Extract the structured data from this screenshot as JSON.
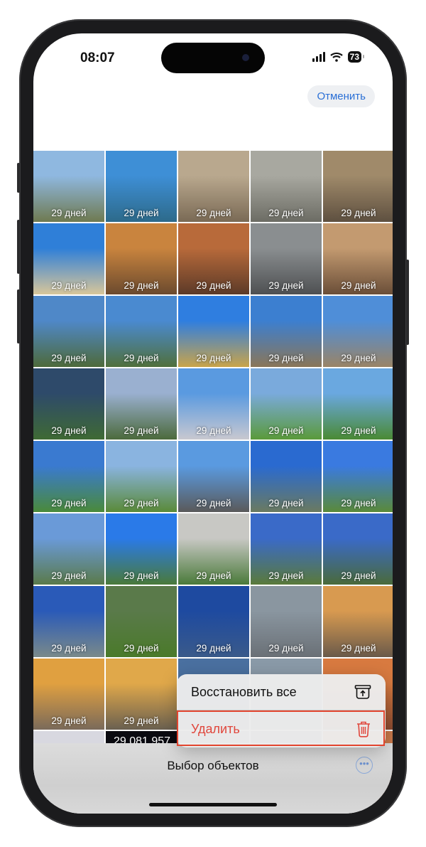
{
  "status_bar": {
    "time": "08:07",
    "battery": "73"
  },
  "header": {
    "cancel_label": "Отменить"
  },
  "tiles": [
    {
      "label": "29 дней",
      "top": "#8fb8e0",
      "bottom": "#6f7a50"
    },
    {
      "label": "29 дней",
      "top": "#3e8fd6",
      "bottom": "#2d6a8a"
    },
    {
      "label": "29 дней",
      "top": "#b9a88e",
      "bottom": "#7a6a55"
    },
    {
      "label": "29 дней",
      "top": "#a8a8a0",
      "bottom": "#6c6c64"
    },
    {
      "label": "29 дней",
      "top": "#a08a6a",
      "bottom": "#5e5040"
    },
    {
      "label": "29 дней",
      "top": "#2f7fd8",
      "bottom": "#d8c69a"
    },
    {
      "label": "29 дней",
      "top": "#c9843e",
      "bottom": "#6b4a2e"
    },
    {
      "label": "29 дней",
      "top": "#b86a3a",
      "bottom": "#5c3a28"
    },
    {
      "label": "29 дней",
      "top": "#8a8e90",
      "bottom": "#4e5052"
    },
    {
      "label": "29 дней",
      "top": "#c39a70",
      "bottom": "#6a4e38"
    },
    {
      "label": "29 дней",
      "top": "#4f88c8",
      "bottom": "#4e6a3a"
    },
    {
      "label": "29 дней",
      "top": "#4a8ad0",
      "bottom": "#50703c"
    },
    {
      "label": "29 дней",
      "top": "#2f7ee0",
      "bottom": "#c9a44a"
    },
    {
      "label": "29 дней",
      "top": "#3c7fd0",
      "bottom": "#8a7658"
    },
    {
      "label": "29 дней",
      "top": "#4f8ed8",
      "bottom": "#9a8466"
    },
    {
      "label": "29 дней",
      "top": "#2e4a6a",
      "bottom": "#3f6a34"
    },
    {
      "label": "29 дней",
      "top": "#9ab0d0",
      "bottom": "#4c6a3c"
    },
    {
      "label": "29 дней",
      "top": "#5a9ae0",
      "bottom": "#c8c8d0"
    },
    {
      "label": "29 дней",
      "top": "#7aaadc",
      "bottom": "#5a9a3a"
    },
    {
      "label": "29 дней",
      "top": "#6aa8e0",
      "bottom": "#4a8a34"
    },
    {
      "label": "29 дней",
      "top": "#3a7ad0",
      "bottom": "#4a8a3a"
    },
    {
      "label": "29 дней",
      "top": "#8ab4e0",
      "bottom": "#5a8a38"
    },
    {
      "label": "29 дней",
      "top": "#5a9ae0",
      "bottom": "#5a5a5a"
    },
    {
      "label": "29 дней",
      "top": "#2a6ad0",
      "bottom": "#6a7a60"
    },
    {
      "label": "29 дней",
      "top": "#3a7ae0",
      "bottom": "#5a8a3a"
    },
    {
      "label": "29 дней",
      "top": "#6a9ad8",
      "bottom": "#5a7a4a"
    },
    {
      "label": "29 дней",
      "top": "#2a7ae8",
      "bottom": "#4a7a3a"
    },
    {
      "label": "29 дней",
      "top": "#c8c8c4",
      "bottom": "#4a7a3a"
    },
    {
      "label": "29 дней",
      "top": "#3a6ac8",
      "bottom": "#5a7a3a"
    },
    {
      "label": "29 дней",
      "top": "#3a6ac8",
      "bottom": "#4a6a3a"
    },
    {
      "label": "29 дней",
      "top": "#2a5ab8",
      "bottom": "#7a8a8a"
    },
    {
      "label": "29 дней",
      "top": "#5a7a4a",
      "bottom": "#4a7a2a"
    },
    {
      "label": "29 дней",
      "top": "#1e4aa0",
      "bottom": "#3a5a8a"
    },
    {
      "label": "29 дней",
      "top": "#8a96a0",
      "bottom": "#6a7076"
    },
    {
      "label": "29 дней",
      "top": "#d89a50",
      "bottom": "#6a5a4a"
    },
    {
      "label": "29 дней",
      "top": "#e0a040",
      "bottom": "#7a6a5a"
    },
    {
      "label": "29 дней",
      "top": "#e0a84a",
      "bottom": "#6a6050"
    },
    {
      "label": "",
      "top": "#4a70a0",
      "bottom": "#5a6a7a"
    },
    {
      "label": "",
      "top": "#8a9aa8",
      "bottom": "#6a7a88"
    },
    {
      "label": "",
      "top": "#d87a40",
      "bottom": "#8a4a30"
    },
    {
      "label": "",
      "top": "#d8d8e0",
      "bottom": "#2a3a5a"
    },
    {
      "label": "",
      "top": "#0a0a10",
      "bottom": "#101018",
      "big": "29 081 957"
    },
    {
      "label": "",
      "top": "#7a8aa0",
      "bottom": "#4a5a6a"
    },
    {
      "label": "",
      "top": "#5a6a7a",
      "bottom": "#3a4a5a"
    },
    {
      "label": "",
      "top": "#c8784a",
      "bottom": "#6a3a2a"
    }
  ],
  "context_menu": {
    "restore_all_label": "Восстановить все",
    "delete_label": "Удалить"
  },
  "bottom_bar": {
    "title": "Выбор объектов"
  },
  "colors": {
    "accent": "#2a6fd6",
    "destructive": "#e0463c",
    "highlight": "#e2452f"
  }
}
